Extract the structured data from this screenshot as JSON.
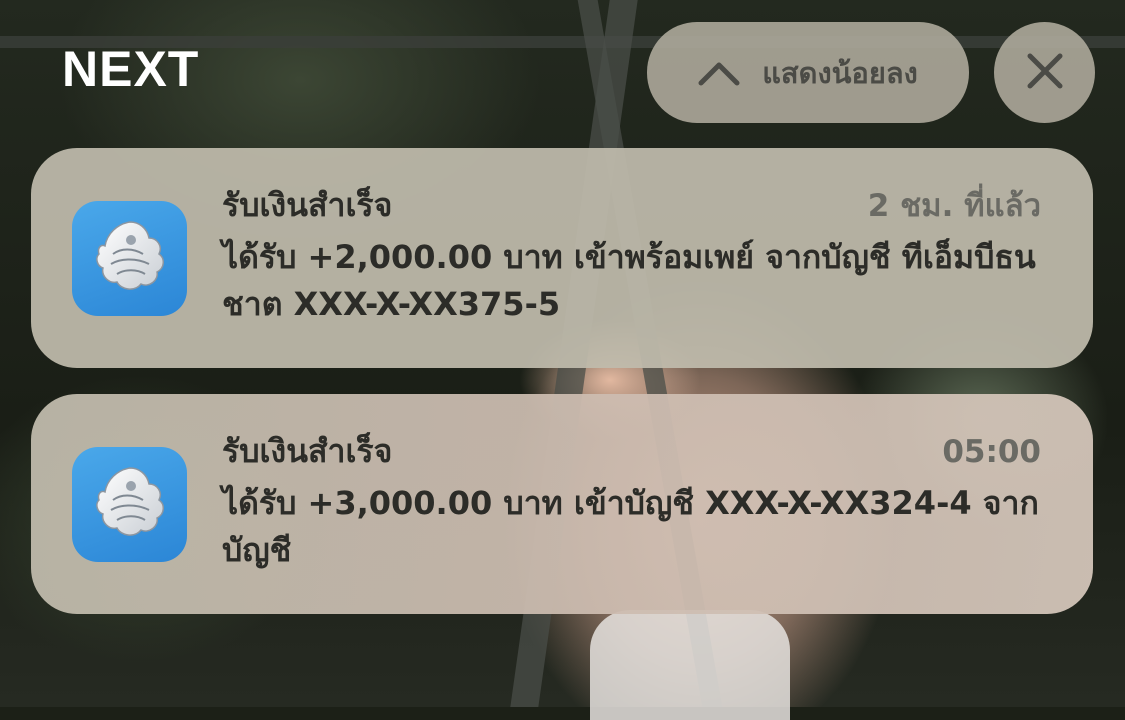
{
  "header": {
    "group_title": "NEXT",
    "show_less_label": "แสดงน้อยลง"
  },
  "notifications": [
    {
      "app_icon": "bank-bird-logo-icon",
      "title": "รับเงินสำเร็จ",
      "time": "2 ชม. ที่แล้ว",
      "body": "ได้รับ +2,000.00 บาท เข้าพร้อมเพย์ จากบัญชี ทีเอ็มบีธนชาต XXX-X-XX375-5"
    },
    {
      "app_icon": "bank-bird-logo-icon",
      "title": "รับเงินสำเร็จ",
      "time": "05:00",
      "body": "ได้รับ +3,000.00 บาท เข้าบัญชี XXX-X-XX324-4 จากบัญชี"
    }
  ],
  "colors": {
    "card_bg": "#c0bbac",
    "icon_blue": "#2b86d6",
    "text_primary": "#2c2c28",
    "text_secondary": "#6a6a64"
  }
}
